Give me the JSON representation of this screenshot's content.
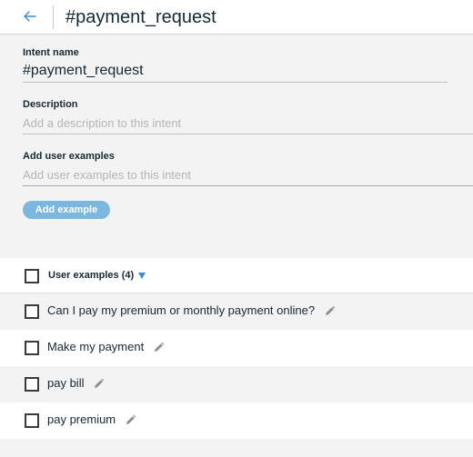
{
  "header": {
    "title": "#payment_request"
  },
  "form": {
    "intent_name_label": "Intent name",
    "intent_name_value": "#payment_request",
    "description_label": "Description",
    "description_placeholder": "Add a description to this intent",
    "examples_label": "Add user examples",
    "examples_placeholder": "Add user examples to this intent",
    "add_button_label": "Add example"
  },
  "list": {
    "header_label": "User examples (4)",
    "items": [
      {
        "text": "Can I pay my premium or monthly payment online?"
      },
      {
        "text": "Make my payment"
      },
      {
        "text": "pay bill"
      },
      {
        "text": "pay premium"
      }
    ]
  },
  "colors": {
    "accent": "#3b8bd0",
    "button": "#7cb7e0"
  },
  "icons": {
    "back": "arrow-left-icon",
    "sort": "caret-down-icon",
    "edit": "pencil-icon"
  }
}
